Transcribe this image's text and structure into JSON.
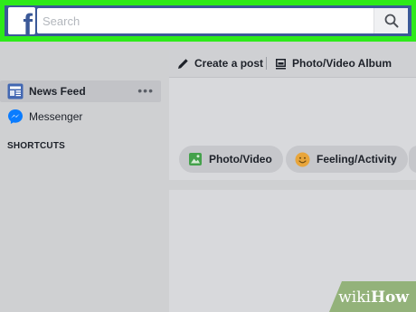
{
  "topbar": {
    "logo_letter": "f",
    "search_placeholder": "Search",
    "search_value": "",
    "highlight_color": "#2eea1a",
    "brand_color": "#3b5998"
  },
  "sidebar": {
    "items": [
      {
        "label": "News Feed",
        "icon": "news-feed-icon",
        "active": true,
        "more": "•••"
      },
      {
        "label": "Messenger",
        "icon": "messenger-icon",
        "active": false
      }
    ],
    "section_title": "SHORTCUTS"
  },
  "composer": {
    "tabs": [
      {
        "label": "Create a post",
        "icon": "pencil-icon"
      },
      {
        "label": "Photo/Video Album",
        "icon": "photo-album-icon"
      }
    ],
    "actions": [
      {
        "label": "Photo/Video",
        "icon": "photo-icon",
        "color": "#44a14b"
      },
      {
        "label": "Feeling/Activity",
        "icon": "smiley-icon",
        "color": "#e8a53b"
      }
    ]
  },
  "watermark": {
    "prefix": "wiki",
    "suffix": "How"
  }
}
